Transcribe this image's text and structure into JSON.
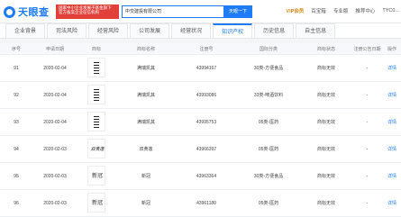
{
  "header": {
    "logo_text": "天眼查",
    "banner_text": "国家中小企业发展子基金旗下 官方备案企业征信机构",
    "search_value": "中交建投有限公司",
    "search_button": "天眼一下",
    "nav": [
      "VIP会员",
      "百宝箱",
      "专业版",
      "推荐中心",
      "TYC0..."
    ]
  },
  "tabs": [
    "企业背景",
    "司法风险",
    "经营风险",
    "公司发展",
    "经营状况",
    "知识产权",
    "历史信息",
    "自主信息"
  ],
  "active_tab": "知识产权",
  "table": {
    "headers": [
      "序号",
      "申请日期",
      "商标",
      "商标名称",
      "注册号",
      "国际分类",
      "商标状态",
      "注册公告日期",
      "操作"
    ],
    "rows": [
      {
        "index": "91",
        "date": "2020-02-04",
        "name": "满瑞凯其",
        "reg": "43994167",
        "class": "30类-方便食品",
        "status": "商标无效",
        "pub": "-",
        "action": "详情"
      },
      {
        "index": "92",
        "date": "2020-02-04",
        "name": "满瑞凯其",
        "reg": "43993086",
        "class": "33类-啤酒饮料",
        "status": "商标无效",
        "pub": "-",
        "action": "详情"
      },
      {
        "index": "93",
        "date": "2020-02-04",
        "name": "满瑞凯其",
        "reg": "43995753",
        "class": "05类-医药",
        "status": "商标无效",
        "pub": "-",
        "action": "详情"
      },
      {
        "index": "94",
        "date": "2020-02-03",
        "name": "双黄莲",
        "reg": "43966397",
        "class": "05类-医药",
        "status": "商标无效",
        "pub": "-",
        "action": "详情"
      },
      {
        "index": "95",
        "date": "2020-02-03",
        "name": "新冠",
        "reg": "43963364",
        "class": "30类-方便食品",
        "status": "商标无效",
        "pub": "-",
        "action": "详情"
      },
      {
        "index": "96",
        "date": "2020-02-03",
        "name": "新冠",
        "reg": "43961180",
        "class": "05类-医药",
        "status": "商标无效",
        "pub": "-",
        "action": "详情"
      }
    ]
  }
}
